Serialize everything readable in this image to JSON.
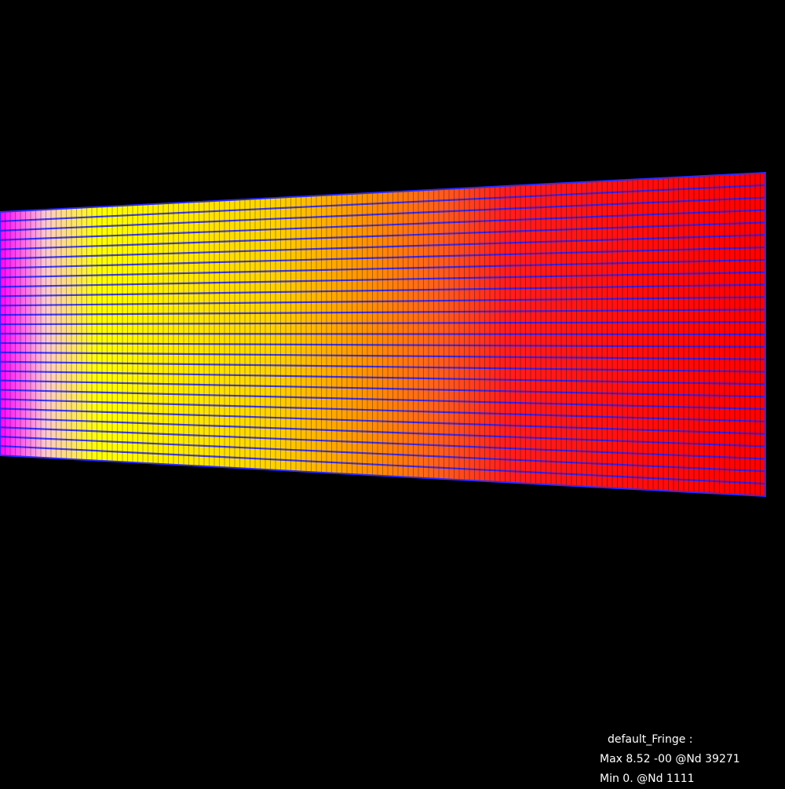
{
  "viewport": {
    "background": "#000000"
  },
  "fringe_plot": {
    "colormap": [
      "#ff00ff",
      "#ffc8d2",
      "#ffff00",
      "#ffd200",
      "#ff9600",
      "#ff5a1e",
      "#ff1e1e",
      "#ff0000"
    ],
    "mesh_line_color": "#1e1eff"
  },
  "legend": {
    "title": "default_Fringe :",
    "max_line": "Max 8.52 -00 @Nd 39271",
    "min_line": "Min 0. @Nd 1111"
  }
}
